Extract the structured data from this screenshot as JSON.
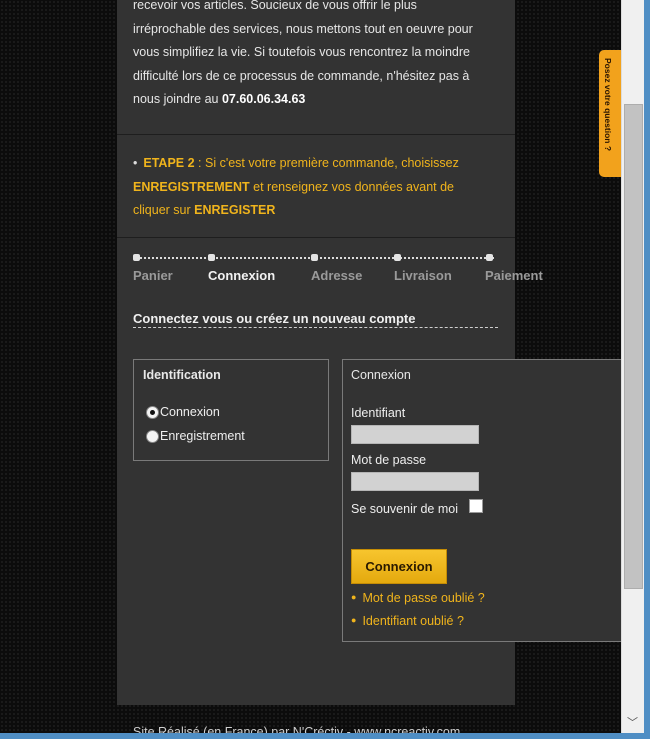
{
  "intro": {
    "line1": "recevoir vos articles. Soucieux de vous offrir le plus",
    "line2": "irréprochable des services, nous mettons tout en oeuvre pour",
    "line3": "vous simplifiez la vie. Si toutefois vous rencontrez la moindre",
    "line4": "difficulté lors de ce processus de commande, n'hésitez pas à",
    "line5_prefix": "nous joindre au ",
    "phone": "07.60.06.34.63"
  },
  "etape": {
    "bullet": "•",
    "label": "ETAPE 2",
    "text1": " : Si c'est votre première commande, choisissez",
    "strong1": "ENREGISTREMENT",
    "text2": " et renseignez vos données avant de",
    "text3": "cliquer sur ",
    "strong2": "ENREGISTER"
  },
  "steps": [
    {
      "label": "Panier",
      "active": false
    },
    {
      "label": "Connexion",
      "active": true
    },
    {
      "label": "Adresse",
      "active": false
    },
    {
      "label": "Livraison",
      "active": false
    },
    {
      "label": "Paiement",
      "active": false
    }
  ],
  "subtitle": "Connectez vous ou créez un nouveau compte",
  "identification": {
    "title": "Identification",
    "options": [
      "Connexion",
      "Enregistrement"
    ],
    "selected": "Connexion"
  },
  "connexion": {
    "title": "Connexion",
    "identifiant_label": "Identifiant",
    "identifiant_value": "",
    "password_label": "Mot de passe",
    "password_value": "",
    "remember_label": "Se souvenir de moi",
    "remember_checked": false,
    "submit": "Connexion",
    "forgot_password": "Mot de passe oublié ?",
    "forgot_id": "Identifiant oublié ?"
  },
  "footer": "Site Réalisé (en France) par N'Créctiv - www.ncreactiv.com",
  "side_tab": "Posez votre question ?",
  "scrollbar": {
    "down_arrow": "﹀"
  },
  "colors": {
    "accent": "#f0b41c",
    "panel": "#333333",
    "background": "#0c0c0c"
  }
}
